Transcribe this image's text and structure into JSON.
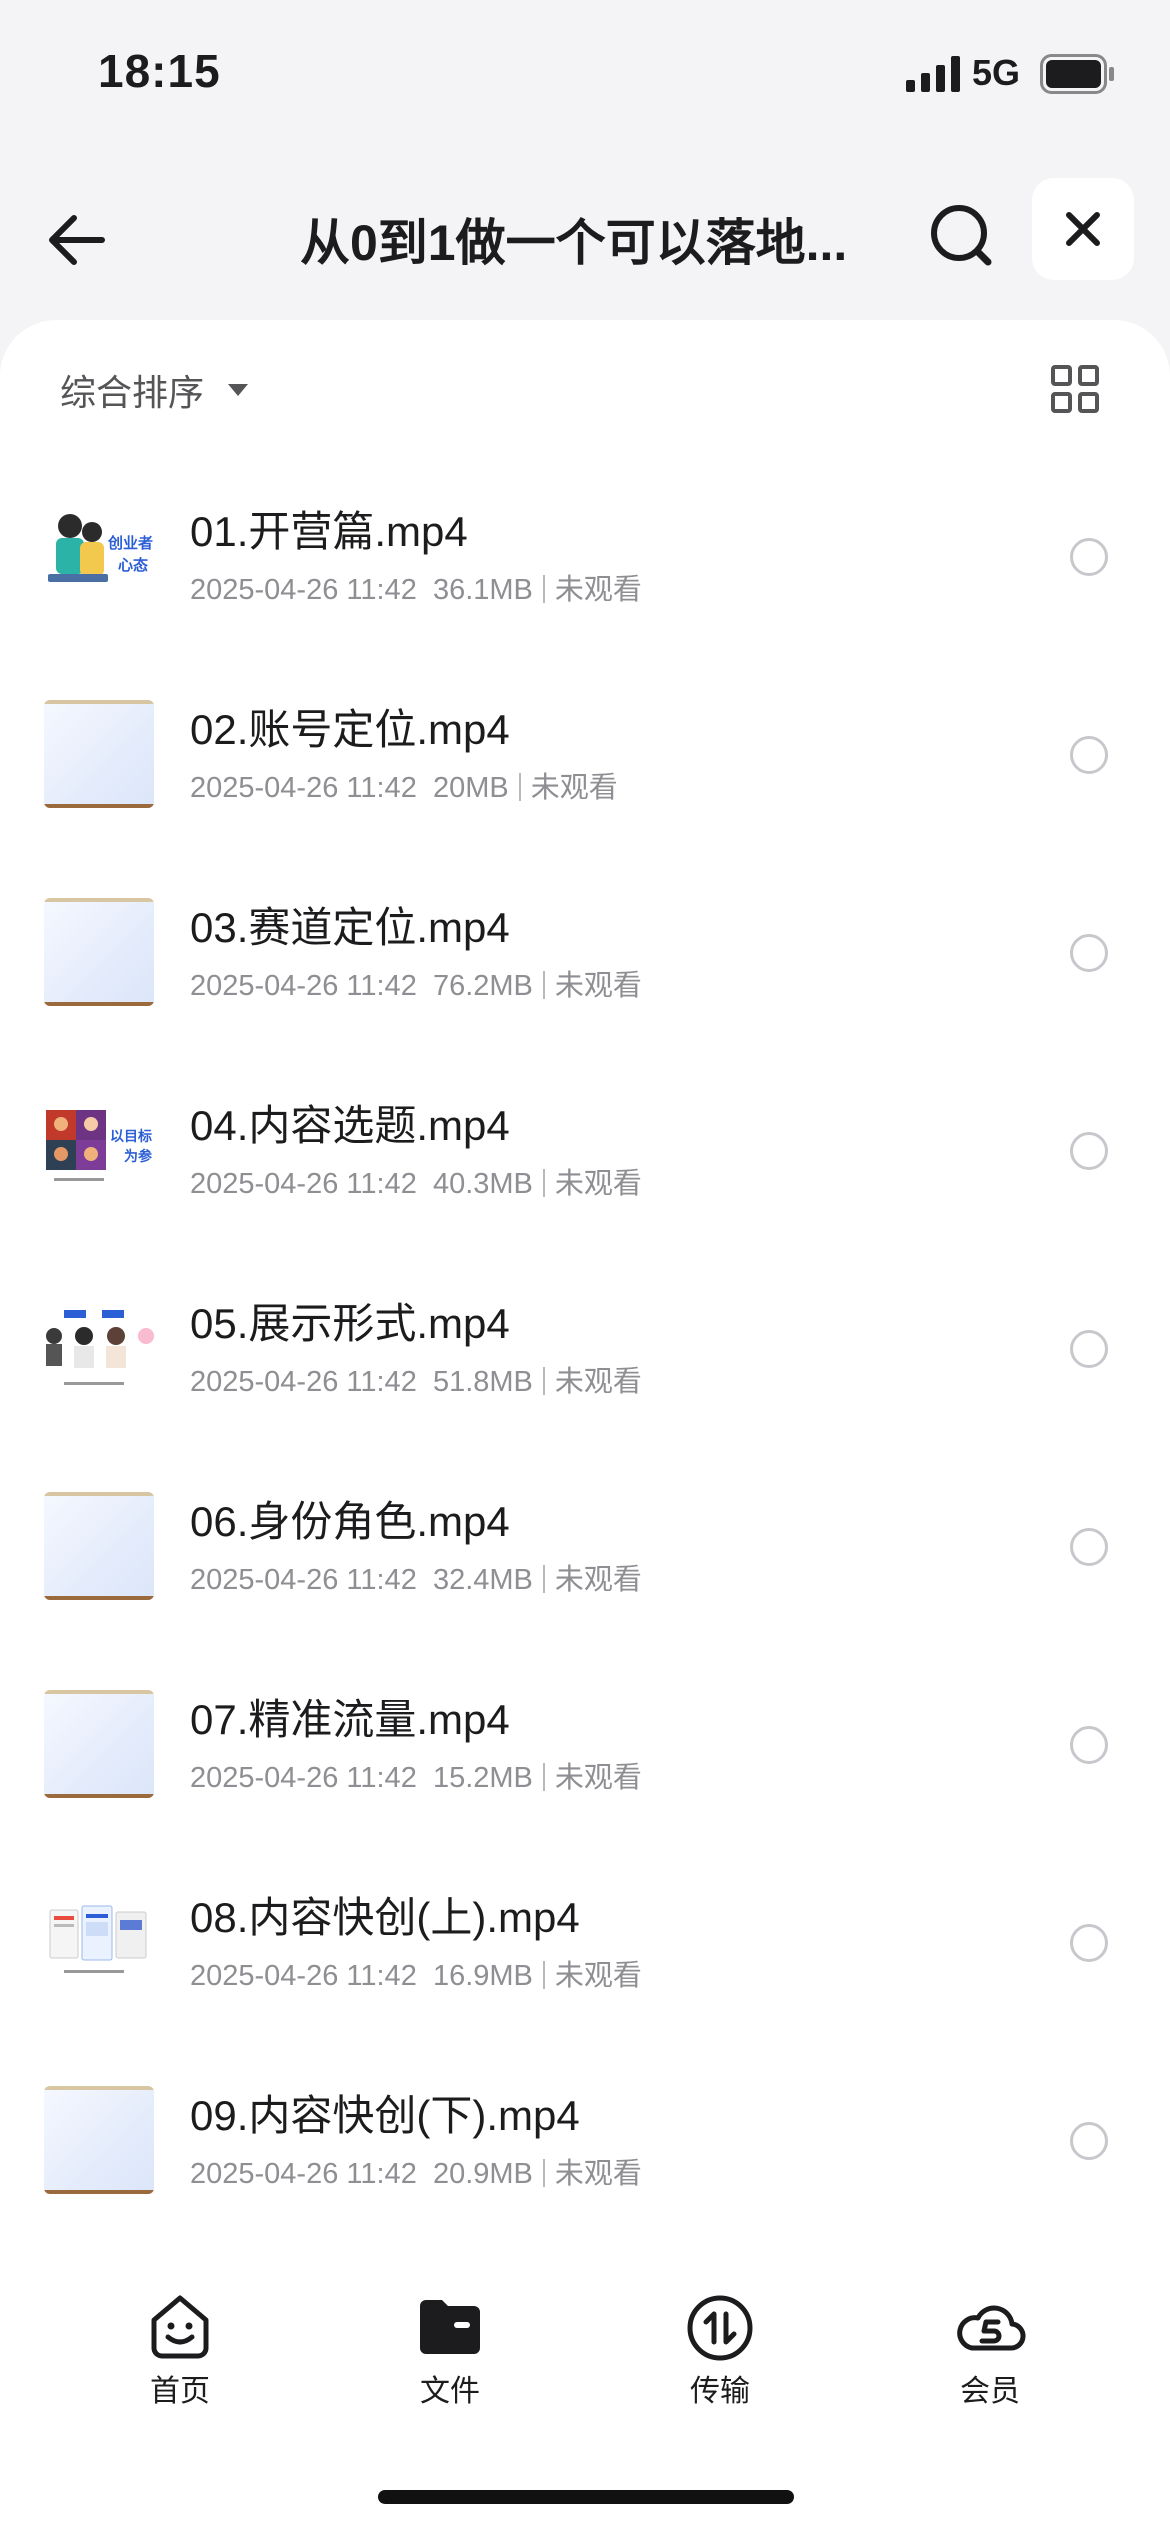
{
  "status_bar": {
    "time": "18:15",
    "network": "5G"
  },
  "header": {
    "title": "从0到1做一个可以落地..."
  },
  "toolbar": {
    "sort_label": "综合排序"
  },
  "files": [
    {
      "name": "01.开营篇.mp4",
      "date": "2025-04-26 11:42",
      "size": "36.1MB",
      "status": "未观看",
      "thumb": "illustration"
    },
    {
      "name": "02.账号定位.mp4",
      "date": "2025-04-26 11:42",
      "size": "20MB",
      "status": "未观看",
      "thumb": "blank"
    },
    {
      "name": "03.赛道定位.mp4",
      "date": "2025-04-26 11:42",
      "size": "76.2MB",
      "status": "未观看",
      "thumb": "blank"
    },
    {
      "name": "04.内容选题.mp4",
      "date": "2025-04-26 11:42",
      "size": "40.3MB",
      "status": "未观看",
      "thumb": "portraits"
    },
    {
      "name": "05.展示形式.mp4",
      "date": "2025-04-26 11:42",
      "size": "51.8MB",
      "status": "未观看",
      "thumb": "people"
    },
    {
      "name": "06.身份角色.mp4",
      "date": "2025-04-26 11:42",
      "size": "32.4MB",
      "status": "未观看",
      "thumb": "blank"
    },
    {
      "name": "07.精准流量.mp4",
      "date": "2025-04-26 11:42",
      "size": "15.2MB",
      "status": "未观看",
      "thumb": "blank"
    },
    {
      "name": "08.内容快创(上).mp4",
      "date": "2025-04-26 11:42",
      "size": "16.9MB",
      "status": "未观看",
      "thumb": "screens"
    },
    {
      "name": "09.内容快创(下).mp4",
      "date": "2025-04-26 11:42",
      "size": "20.9MB",
      "status": "未观看",
      "thumb": "blank"
    }
  ],
  "thumb_text": {
    "t1": "创业者",
    "t2": "心态",
    "t4a": "以目标",
    "t4b": "为参"
  },
  "nav": [
    {
      "label": "首页",
      "icon": "home-face-icon"
    },
    {
      "label": "文件",
      "icon": "folder-icon"
    },
    {
      "label": "传输",
      "icon": "transfer-icon"
    },
    {
      "label": "会员",
      "icon": "vip-cloud-icon"
    }
  ]
}
